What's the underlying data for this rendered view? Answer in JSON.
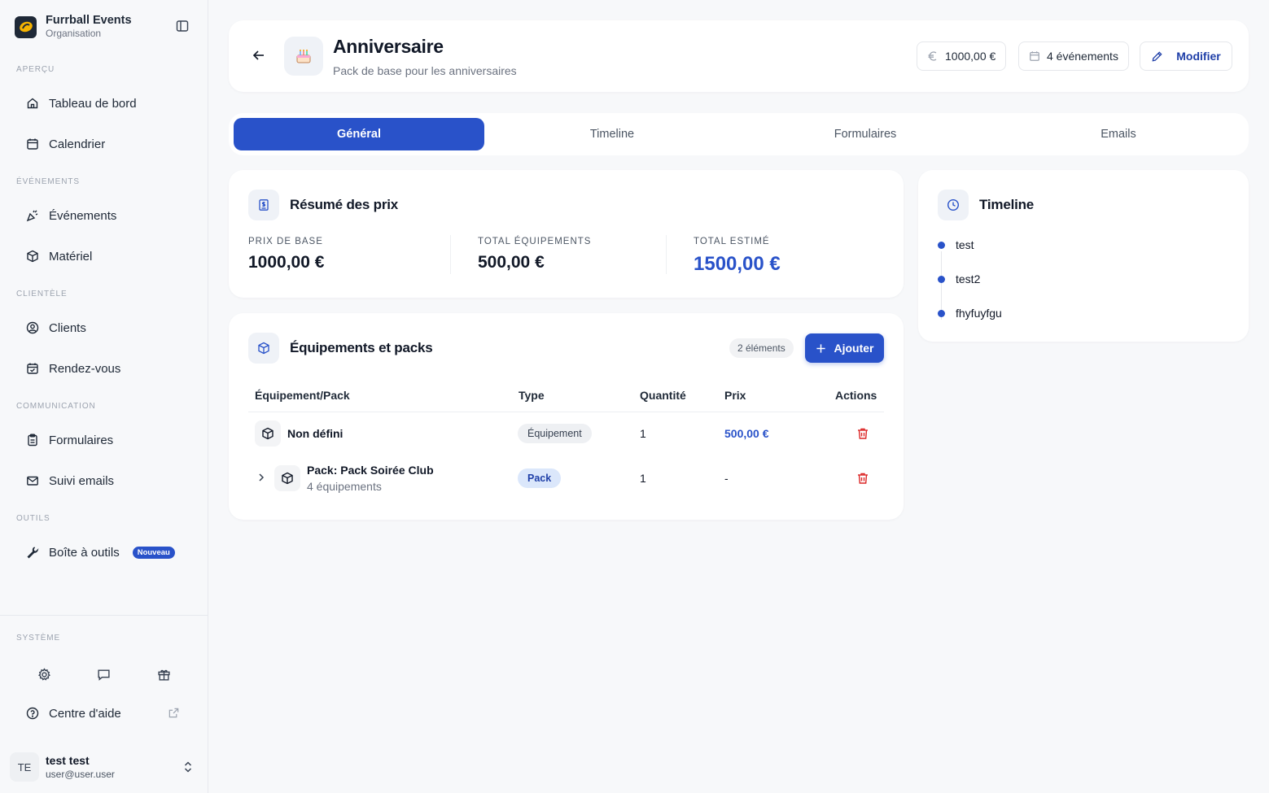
{
  "org": {
    "name": "Furrball Events",
    "subtitle": "Organisation"
  },
  "sidebar": {
    "sections": {
      "overview": "APERÇU",
      "events": "ÉVÉNEMENTS",
      "clients": "CLIENTÈLE",
      "communication": "COMMUNICATION",
      "tools": "OUTILS",
      "system": "SYSTÈME"
    },
    "items": {
      "dashboard": "Tableau de bord",
      "calendar": "Calendrier",
      "events": "Événements",
      "equipment": "Matériel",
      "clients": "Clients",
      "appointments": "Rendez-vous",
      "forms": "Formulaires",
      "emails": "Suivi emails",
      "toolbox": "Boîte à outils",
      "toolbox_badge": "Nouveau",
      "help": "Centre d'aide"
    }
  },
  "user": {
    "initials": "TE",
    "name": "test test",
    "email": "user@user.user"
  },
  "header": {
    "title": "Anniversaire",
    "subtitle": "Pack de base pour les anniversaires",
    "price": "1000,00 €",
    "events": "4 événements",
    "edit": "Modifier",
    "icon": "birthday-cake-icon"
  },
  "tabs": [
    "Général",
    "Timeline",
    "Formulaires",
    "Emails"
  ],
  "prices": {
    "title": "Résumé des prix",
    "base_label": "PRIX DE BASE",
    "base_value": "1000,00 €",
    "equip_label": "TOTAL ÉQUIPEMENTS",
    "equip_value": "500,00 €",
    "total_label": "TOTAL ESTIMÉ",
    "total_value": "1500,00 €"
  },
  "equipment": {
    "title": "Équipements et packs",
    "count": "2 éléments",
    "add": "Ajouter",
    "columns": [
      "Équipement/Pack",
      "Type",
      "Quantité",
      "Prix",
      "Actions"
    ],
    "rows": [
      {
        "name": "Non défini",
        "sub": "",
        "type": "Équipement",
        "qty": "1",
        "price": "500,00 €"
      },
      {
        "name": "Pack: Pack Soirée Club",
        "sub": "4 équipements",
        "type": "Pack",
        "qty": "1",
        "price": "-"
      }
    ]
  },
  "timeline": {
    "title": "Timeline",
    "items": [
      "test",
      "test2",
      "fhyfuyfgu"
    ]
  },
  "colors": {
    "accent": "#2952c9",
    "danger": "#dc2626"
  }
}
